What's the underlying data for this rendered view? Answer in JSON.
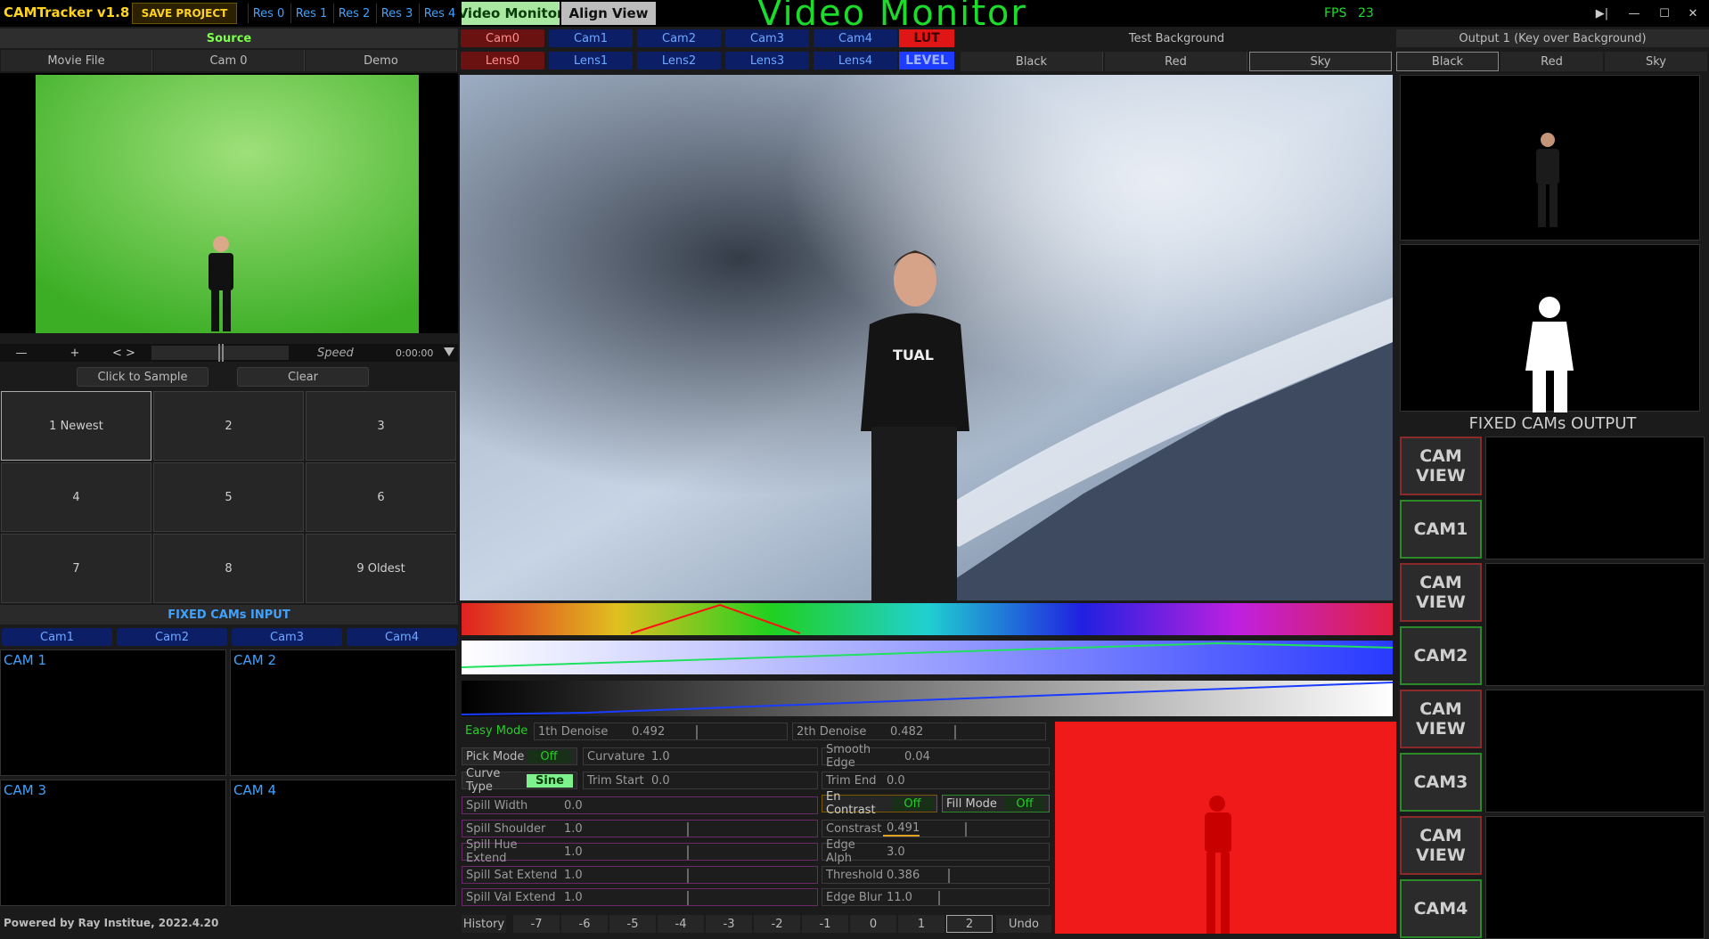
{
  "app": {
    "title": "CAMTracker v1.8",
    "save_label": "SAVE PROJECT"
  },
  "res_tabs": [
    "Res 0",
    "Res 1",
    "Res 2",
    "Res 3",
    "Res 4"
  ],
  "view_tabs": {
    "video_monitor": "Video Monitor",
    "align_view": "Align View"
  },
  "banner": "Video Monitor",
  "fps": {
    "label": "FPS",
    "value": "23"
  },
  "window_controls": {
    "skip": "▶|",
    "minimize": "—",
    "maximize": "☐",
    "close": "✕"
  },
  "source": {
    "title": "Source",
    "tabs": [
      "Movie File",
      "Cam 0",
      "Demo"
    ],
    "player": {
      "minus": "—",
      "plus": "+",
      "seek": "< >",
      "speed": "Speed",
      "time": "0:00:00"
    },
    "click_to_sample": "Click to Sample",
    "clear": "Clear",
    "history_grid": [
      "1 Newest",
      "2",
      "3",
      "4",
      "5",
      "6",
      "7",
      "8",
      "9 Oldest"
    ]
  },
  "fixed_input": {
    "title": "FIXED CAMs INPUT",
    "tabs": [
      "Cam1",
      "Cam2",
      "Cam3",
      "Cam4"
    ],
    "views": [
      "CAM 1",
      "CAM 2",
      "CAM 3",
      "CAM 4"
    ]
  },
  "footer": "Powered by Ray Institue, 2022.4.20",
  "cam_row": [
    "Cam0",
    "Cam1",
    "Cam2",
    "Cam3",
    "Cam4"
  ],
  "lens_row": [
    "Lens0",
    "Lens1",
    "Lens2",
    "Lens3",
    "Lens4"
  ],
  "lut": "LUT",
  "level": "LEVEL",
  "test_background": {
    "title": "Test Background",
    "options": [
      "Black",
      "Red",
      "Sky"
    ]
  },
  "output": {
    "title": "Output 1 (Key over Background)",
    "options": [
      "Black",
      "Red",
      "Sky"
    ]
  },
  "fixed_output": {
    "title": "FIXED CAMs OUTPUT",
    "buttons": [
      "CAM\nVIEW",
      "CAM1",
      "CAM\nVIEW",
      "CAM2",
      "CAM\nVIEW",
      "CAM3",
      "CAM\nVIEW",
      "CAM4"
    ]
  },
  "controls": {
    "easy_mode": "Easy Mode",
    "denoise1": {
      "label": "1th Denoise",
      "value": "0.492"
    },
    "denoise2": {
      "label": "2th Denoise",
      "value": "0.482"
    },
    "pick_mode": {
      "label": "Pick Mode",
      "value": "Off"
    },
    "curvature": {
      "label": "Curvature",
      "value": "1.0"
    },
    "smooth_edge": {
      "label": "Smooth Edge",
      "value": "0.04"
    },
    "curve_type": {
      "label": "Curve Type",
      "value": "Sine"
    },
    "trim_start": {
      "label": "Trim Start",
      "value": "0.0"
    },
    "trim_end": {
      "label": "Trim End",
      "value": "0.0"
    },
    "spill_width": {
      "label": "Spill Width",
      "value": "0.0"
    },
    "en_contrast": {
      "label": "En Contrast",
      "value": "Off"
    },
    "fill_mode": {
      "label": "Fill Mode",
      "value": "Off"
    },
    "spill_shoulder": {
      "label": "Spill Shoulder",
      "value": "1.0"
    },
    "contrast": {
      "label": "Constrast",
      "value": "0.491"
    },
    "spill_hue": {
      "label": "Spill Hue Extend",
      "value": "1.0"
    },
    "edge_alph": {
      "label": "Edge Alph",
      "value": "3.0"
    },
    "spill_sat": {
      "label": "Spill Sat Extend",
      "value": "1.0"
    },
    "threshold": {
      "label": "Threshold",
      "value": "0.386"
    },
    "spill_val": {
      "label": "Spill Val Extend",
      "value": "1.0"
    },
    "edge_blur": {
      "label": "Edge Blur",
      "value": "11.0"
    }
  },
  "history": {
    "label": "History",
    "steps": [
      "-7",
      "-6",
      "-5",
      "-4",
      "-3",
      "-2",
      "-1",
      "0",
      "1",
      "2"
    ],
    "undo": "Undo"
  },
  "colors": {
    "accent_green": "#7cff4a",
    "banner_green": "#1bdc2a",
    "title_yellow": "#ffd21e",
    "res_blue": "#3fa2ff",
    "cam_blue": "#0c1f66",
    "lut_red": "#e01515",
    "level_blue": "#1d3cff"
  }
}
